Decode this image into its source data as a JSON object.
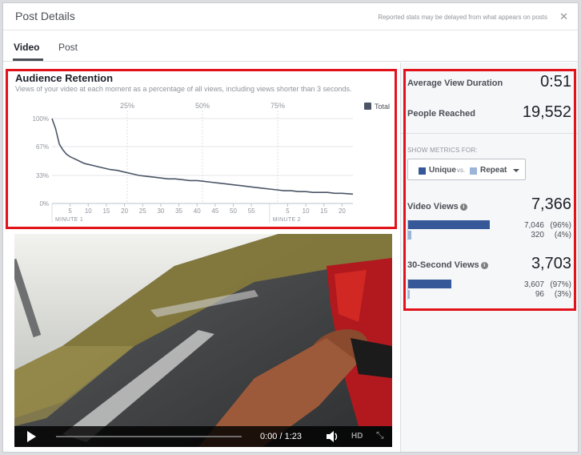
{
  "header": {
    "title": "Post Details",
    "note": "Reported stats may be delayed from what appears on posts",
    "close": "✕"
  },
  "tabs": [
    {
      "label": "Video",
      "active": true
    },
    {
      "label": "Post",
      "active": false
    }
  ],
  "retention": {
    "title": "Audience Retention",
    "subtitle": "Views of your video at each moment as a percentage of all views, including views shorter than 3 seconds.",
    "legend": "Total",
    "color": "#4b5566"
  },
  "chart_data": {
    "type": "line",
    "title": "Audience Retention",
    "ylim": [
      0,
      100
    ],
    "ytick_labels": [
      "100%",
      "67%",
      "33%",
      "0%"
    ],
    "ytick_values": [
      100,
      67,
      33,
      0
    ],
    "top_markers": [
      {
        "label": "25%",
        "t": 20.75
      },
      {
        "label": "50%",
        "t": 41.5
      },
      {
        "label": "75%",
        "t": 62.25
      }
    ],
    "xlim": [
      0,
      83
    ],
    "xtick_labels": [
      "5",
      "10",
      "15",
      "20",
      "25",
      "30",
      "35",
      "40",
      "45",
      "50",
      "55",
      "5",
      "10",
      "15",
      "20"
    ],
    "xtick_values": [
      5,
      10,
      15,
      20,
      25,
      30,
      35,
      40,
      45,
      50,
      55,
      65,
      70,
      75,
      80
    ],
    "minute_labels": [
      {
        "label": "MINUTE 1",
        "t": 0
      },
      {
        "label": "MINUTE 2",
        "t": 60
      }
    ],
    "grid": true,
    "legend_placement": "top-right",
    "series": [
      {
        "name": "Total",
        "x": [
          0,
          1,
          2,
          3,
          4,
          5,
          6,
          7,
          8,
          9,
          10,
          12,
          14,
          16,
          18,
          20,
          22,
          24,
          26,
          28,
          30,
          32,
          34,
          36,
          38,
          40,
          42,
          44,
          46,
          48,
          50,
          52,
          54,
          56,
          58,
          60,
          62,
          64,
          66,
          68,
          70,
          72,
          74,
          76,
          78,
          80,
          83
        ],
        "y": [
          100,
          88,
          70,
          63,
          58,
          55,
          53,
          51,
          49,
          47,
          46,
          44,
          42,
          40,
          39,
          37,
          35,
          33,
          32,
          31,
          30,
          29,
          29,
          28,
          27,
          27,
          26,
          25,
          24,
          23,
          22,
          21,
          20,
          19,
          18,
          17,
          16,
          15,
          15,
          14,
          14,
          13,
          13,
          13,
          12,
          12,
          11
        ]
      }
    ]
  },
  "video": {
    "time": "0:00 / 1:23",
    "hd": "HD",
    "progress": 0
  },
  "metrics": {
    "avg_view_duration": {
      "label": "Average View Duration",
      "value": "0:51"
    },
    "people_reached": {
      "label": "People Reached",
      "value": "19,552"
    },
    "show_metrics_for": "SHOW METRICS FOR:",
    "dropdown": {
      "unique": "Unique",
      "vs": "vs.",
      "repeat": "Repeat",
      "unique_color": "#365899",
      "repeat_color": "#9cb4d8"
    },
    "video_views": {
      "label": "Video Views",
      "total": "7,366",
      "unique_value": "7,046",
      "unique_pct": "(96%)",
      "repeat_value": "320",
      "repeat_pct": "(4%)",
      "unique_fraction": 0.96,
      "repeat_fraction": 0.04
    },
    "thirty_second_views": {
      "label": "30-Second Views",
      "total": "3,703",
      "unique_value": "3,607",
      "unique_pct": "(97%)",
      "repeat_value": "96",
      "repeat_pct": "(3%)",
      "unique_fraction": 0.97,
      "repeat_fraction": 0.03
    }
  },
  "colors": {
    "highlight": "#e2121a",
    "accent": "#365899"
  }
}
